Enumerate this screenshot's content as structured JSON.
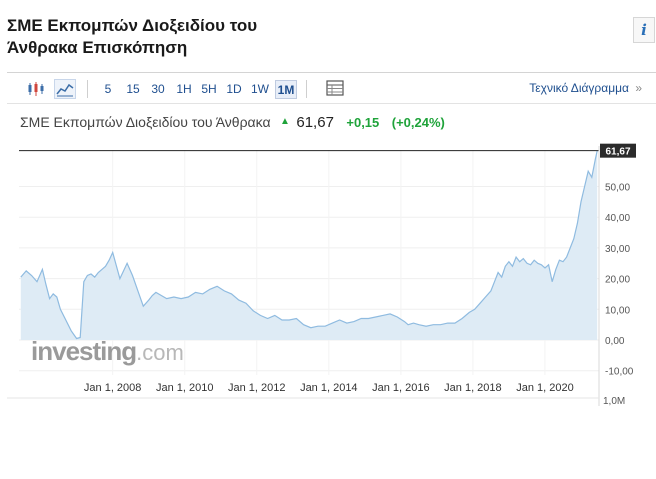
{
  "page": {
    "title": "ΣΜΕ Εκπομπών Διοξειδίου του Άνθρακα Επισκόπηση",
    "info_label": "i"
  },
  "toolbar": {
    "chart_type_icons": [
      "candlestick-icon",
      "line-chart-icon"
    ],
    "intervals": [
      "5",
      "15",
      "30",
      "1H",
      "5H",
      "1D",
      "1W",
      "1M"
    ],
    "active_interval": "1M",
    "table_icon": "table-icon",
    "technical_chart_link": "Τεχνικό Διάγραμμα",
    "link_arrow": "»"
  },
  "quote": {
    "name": "ΣΜΕ Εκπομπών Διοξειδίου του Άνθρακα",
    "direction_icon": "up-arrow-icon",
    "price": "61,67",
    "change": "+0,15",
    "change_pct": "(+0,24%)",
    "up_color": "#1fa33a"
  },
  "watermark": {
    "part1": "investing",
    "part2": ".com"
  },
  "chart_data": {
    "type": "area",
    "title": "",
    "xlabel": "",
    "ylabel": "",
    "x_ticks": [
      "Jan 1, 2008",
      "Jan 1, 2010",
      "Jan 1, 2012",
      "Jan 1, 2014",
      "Jan 1, 2016",
      "Jan 1, 2018",
      "Jan 1, 2020"
    ],
    "y_ticks": [
      "61,67",
      "50,00",
      "40,00",
      "30,00",
      "20,00",
      "10,00",
      "0,00",
      "-10,00"
    ],
    "volume_label": "1,0M",
    "ylim": [
      -10,
      62
    ],
    "xlim": [
      2005.4,
      2021.5
    ],
    "current_value": 61.67,
    "current_value_label": "61,67",
    "area_color": "#deebf5",
    "line_color": "#8fbbe0",
    "grid": true,
    "series": [
      {
        "x": [
          2005.45,
          2005.6,
          2005.75,
          2005.9,
          2006.05,
          2006.15,
          2006.25,
          2006.35,
          2006.45,
          2006.55,
          2006.7,
          2006.85,
          2007.0,
          2007.1,
          2007.2,
          2007.3,
          2007.4,
          2007.5,
          2007.6,
          2007.7,
          2007.8,
          2007.9,
          2008.0,
          2008.2,
          2008.4,
          2008.55,
          2008.7,
          2008.85,
          2009.0,
          2009.1,
          2009.2,
          2009.35,
          2009.5,
          2009.7,
          2009.9,
          2010.1,
          2010.3,
          2010.5,
          2010.7,
          2010.9,
          2011.1,
          2011.3,
          2011.5,
          2011.7,
          2011.9,
          2012.1,
          2012.3,
          2012.5,
          2012.7,
          2012.9,
          2013.1,
          2013.3,
          2013.5,
          2013.7,
          2013.9,
          2014.1,
          2014.3,
          2014.5,
          2014.7,
          2014.9,
          2015.1,
          2015.3,
          2015.5,
          2015.7,
          2015.9,
          2016.1,
          2016.2,
          2016.35,
          2016.5,
          2016.7,
          2016.9,
          2017.1,
          2017.3,
          2017.5,
          2017.7,
          2017.9,
          2018.05,
          2018.2,
          2018.35,
          2018.5,
          2018.6,
          2018.7,
          2018.8,
          2018.9,
          2019.0,
          2019.1,
          2019.2,
          2019.3,
          2019.4,
          2019.5,
          2019.6,
          2019.7,
          2019.8,
          2019.9,
          2020.0,
          2020.1,
          2020.2,
          2020.3,
          2020.4,
          2020.5,
          2020.6,
          2020.7,
          2020.8,
          2020.9,
          2021.0,
          2021.1,
          2021.2,
          2021.3,
          2021.4,
          2021.45
        ],
        "values": [
          20.5,
          22.5,
          21.0,
          19.0,
          23.0,
          18.0,
          13.5,
          15.0,
          14.0,
          10.0,
          6.5,
          3.0,
          0.5,
          0.8,
          19.0,
          21.0,
          21.5,
          20.5,
          22.0,
          23.0,
          24.0,
          26.0,
          28.5,
          20.0,
          25.0,
          21.0,
          16.0,
          11.0,
          13.0,
          14.5,
          15.5,
          14.5,
          13.5,
          14.0,
          13.5,
          14.0,
          15.5,
          15.0,
          16.5,
          17.5,
          16.0,
          15.0,
          13.0,
          12.0,
          9.5,
          8.0,
          7.0,
          8.0,
          6.5,
          6.5,
          7.0,
          5.0,
          4.0,
          4.5,
          4.5,
          5.5,
          6.5,
          5.5,
          6.0,
          7.0,
          7.0,
          7.5,
          8.0,
          8.5,
          7.5,
          6.0,
          5.0,
          5.5,
          5.0,
          4.5,
          5.0,
          5.0,
          5.5,
          5.5,
          7.0,
          9.0,
          10.0,
          12.0,
          14.0,
          16.0,
          19.0,
          22.0,
          20.5,
          24.0,
          25.5,
          24.0,
          27.0,
          25.5,
          26.5,
          25.0,
          24.5,
          26.0,
          25.0,
          24.5,
          23.5,
          24.5,
          19.0,
          23.0,
          26.0,
          25.5,
          27.0,
          30.0,
          33.0,
          38.0,
          45.0,
          50.0,
          55.0,
          53.0,
          59.0,
          61.67
        ]
      }
    ]
  }
}
